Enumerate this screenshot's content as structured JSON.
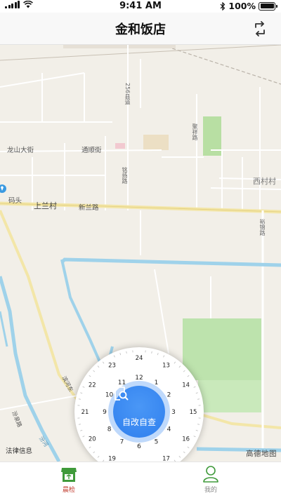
{
  "status_bar": {
    "time": "9:41 AM",
    "battery": "100%",
    "battery_level": 1.0
  },
  "nav": {
    "title": "金和饭店",
    "switch_icon": "switch-arrows-icon"
  },
  "map": {
    "labels": {
      "longshan_street": "龙山大街",
      "tongshun_street": "通顺街",
      "shanglan_village": "上兰村",
      "xinlan_road": "新兰路",
      "xicun_village": "西村村",
      "wharf": "码头",
      "county_road_256": "256县道",
      "mingyang_road": "铭扬路",
      "juxiang_road": "聚祥路",
      "yujing_road": "裕锦路",
      "binhe_east_road": "滨河东",
      "fenhe": "汾河",
      "fenquan_road": "汾泉路",
      "legal_info": "法律信息",
      "credit": "高德地图"
    }
  },
  "clock": {
    "button_label": "自改自查",
    "button_icon": "search-document-icon",
    "inner_numbers": [
      "12",
      "1",
      "2",
      "3",
      "4",
      "5",
      "6",
      "7",
      "8",
      "9",
      "10",
      "11"
    ],
    "outer_numbers": [
      "24",
      "13",
      "14",
      "15",
      "16",
      "17",
      "18",
      "19",
      "20",
      "21",
      "22",
      "23"
    ]
  },
  "tabs": [
    {
      "label": "晨检",
      "icon": "store-icon",
      "active": true
    },
    {
      "label": "我的",
      "icon": "person-icon",
      "active": false
    }
  ],
  "colors": {
    "accent_blue": "#2f7fee",
    "active_tab": "#c0392b",
    "store_icon_green": "#3f9a3a"
  }
}
